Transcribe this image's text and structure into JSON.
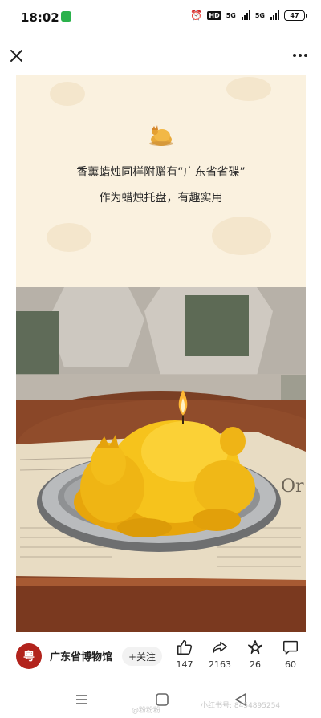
{
  "status_bar": {
    "time": "18:02",
    "hd_label": "HD",
    "signal_1_label": "5G",
    "signal_2_label": "5G",
    "battery": "47"
  },
  "post": {
    "caption_line_1": "香薰蜡烛同样附赠有“广东省省碟”",
    "caption_line_2": "作为蜡烛托盘，有趣实用",
    "panel_color": "#faf1df"
  },
  "account": {
    "name": "广东省博物馆",
    "avatar_glyph": "粤",
    "follow_label": "+关注"
  },
  "actions": {
    "likes": "147",
    "shares": "2163",
    "stars": "26",
    "comments": "60"
  },
  "watermarks": {
    "weibo": "@粉粉粉",
    "xiaohongshu": "小红书号: 8454895254"
  },
  "icons": [
    "close-icon",
    "more-icon",
    "rooster-icon",
    "like-icon",
    "share-icon",
    "star-icon",
    "comment-icon",
    "menu-nav-icon",
    "home-nav-icon",
    "back-nav-icon"
  ]
}
